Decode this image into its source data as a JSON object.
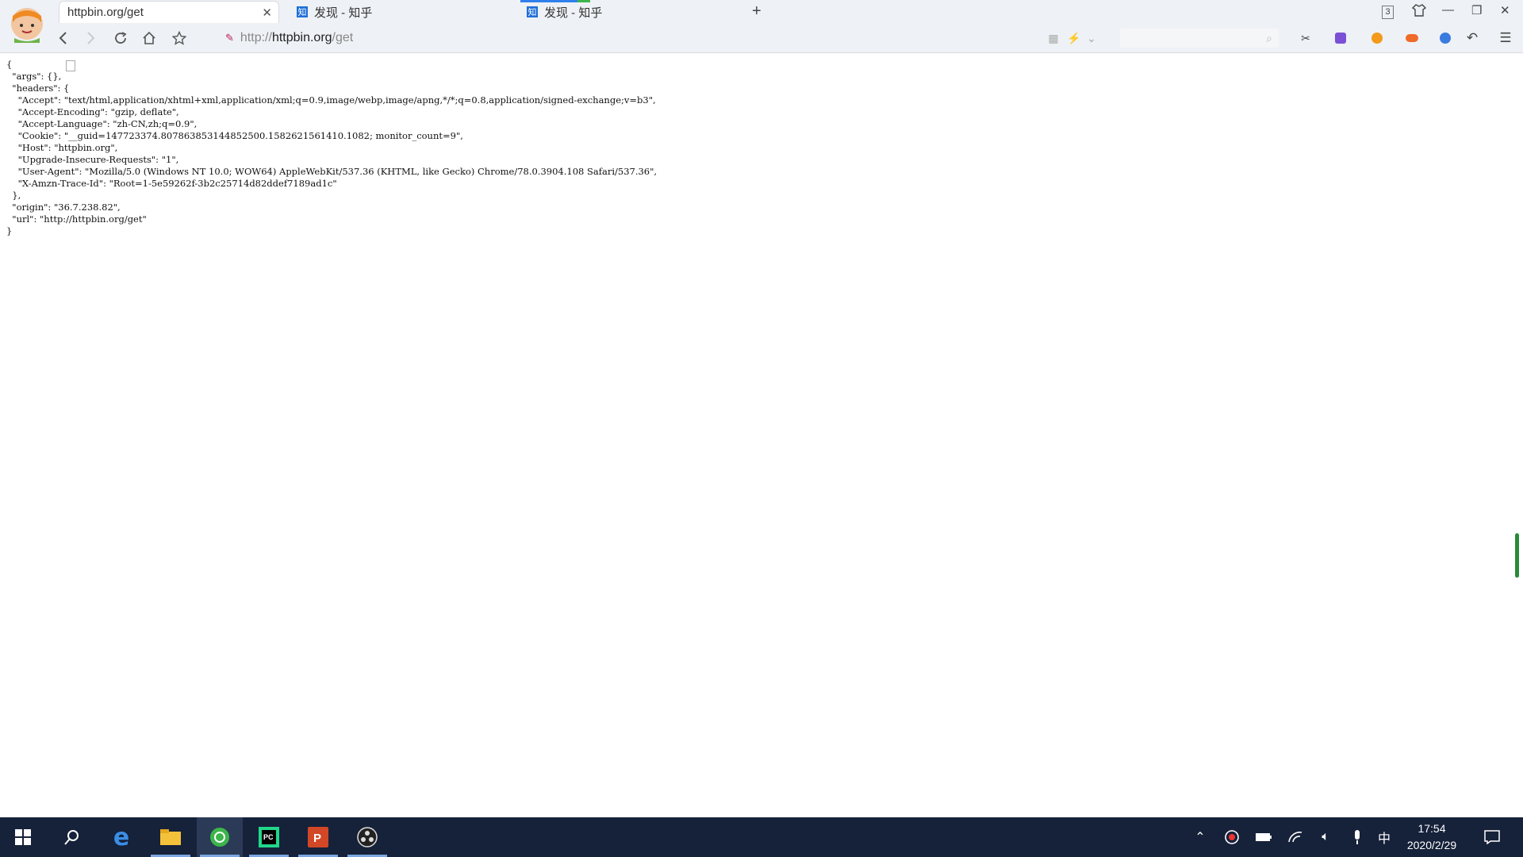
{
  "browser": {
    "tabs": [
      {
        "label": "httpbin.org/get",
        "active": true
      },
      {
        "label": "发现 - 知乎",
        "active": false
      },
      {
        "label": "发现 - 知乎",
        "active": false
      }
    ],
    "tab_favicon_zhihu": "知",
    "tab_counter": "3",
    "address": {
      "scheme": "http://",
      "host": "httpbin.org",
      "path": "/get"
    }
  },
  "page": {
    "lines": [
      "{",
      "  \"args\": {},",
      "  \"headers\": {",
      "    \"Accept\": \"text/html,application/xhtml+xml,application/xml;q=0.9,image/webp,image/apng,*/*;q=0.8,application/signed-exchange;v=b3\",",
      "    \"Accept-Encoding\": \"gzip, deflate\",",
      "    \"Accept-Language\": \"zh-CN,zh;q=0.9\",",
      "    \"Cookie\": \"__guid=147723374.807863853144852500.1582621561410.1082; monitor_count=9\",",
      "    \"Host\": \"httpbin.org\",",
      "    \"Upgrade-Insecure-Requests\": \"1\",",
      "    \"User-Agent\": \"Mozilla/5.0 (Windows NT 10.0; WOW64) AppleWebKit/537.36 (KHTML, like Gecko) Chrome/78.0.3904.108 Safari/537.36\",",
      "    \"X-Amzn-Trace-Id\": \"Root=1-5e59262f-3b2c25714d82ddef7189ad1c\"",
      "  },",
      "  \"origin\": \"36.7.238.82\",",
      "  \"url\": \"http://httpbin.org/get\"",
      "}"
    ]
  },
  "taskbar": {
    "ime": "中",
    "time": "17:54",
    "date": "2020/2/29"
  },
  "colors": {
    "taskbar_bg": "#16213a",
    "chrome_bg": "#eef1f5",
    "scrollbar": "#2a8a3a"
  }
}
